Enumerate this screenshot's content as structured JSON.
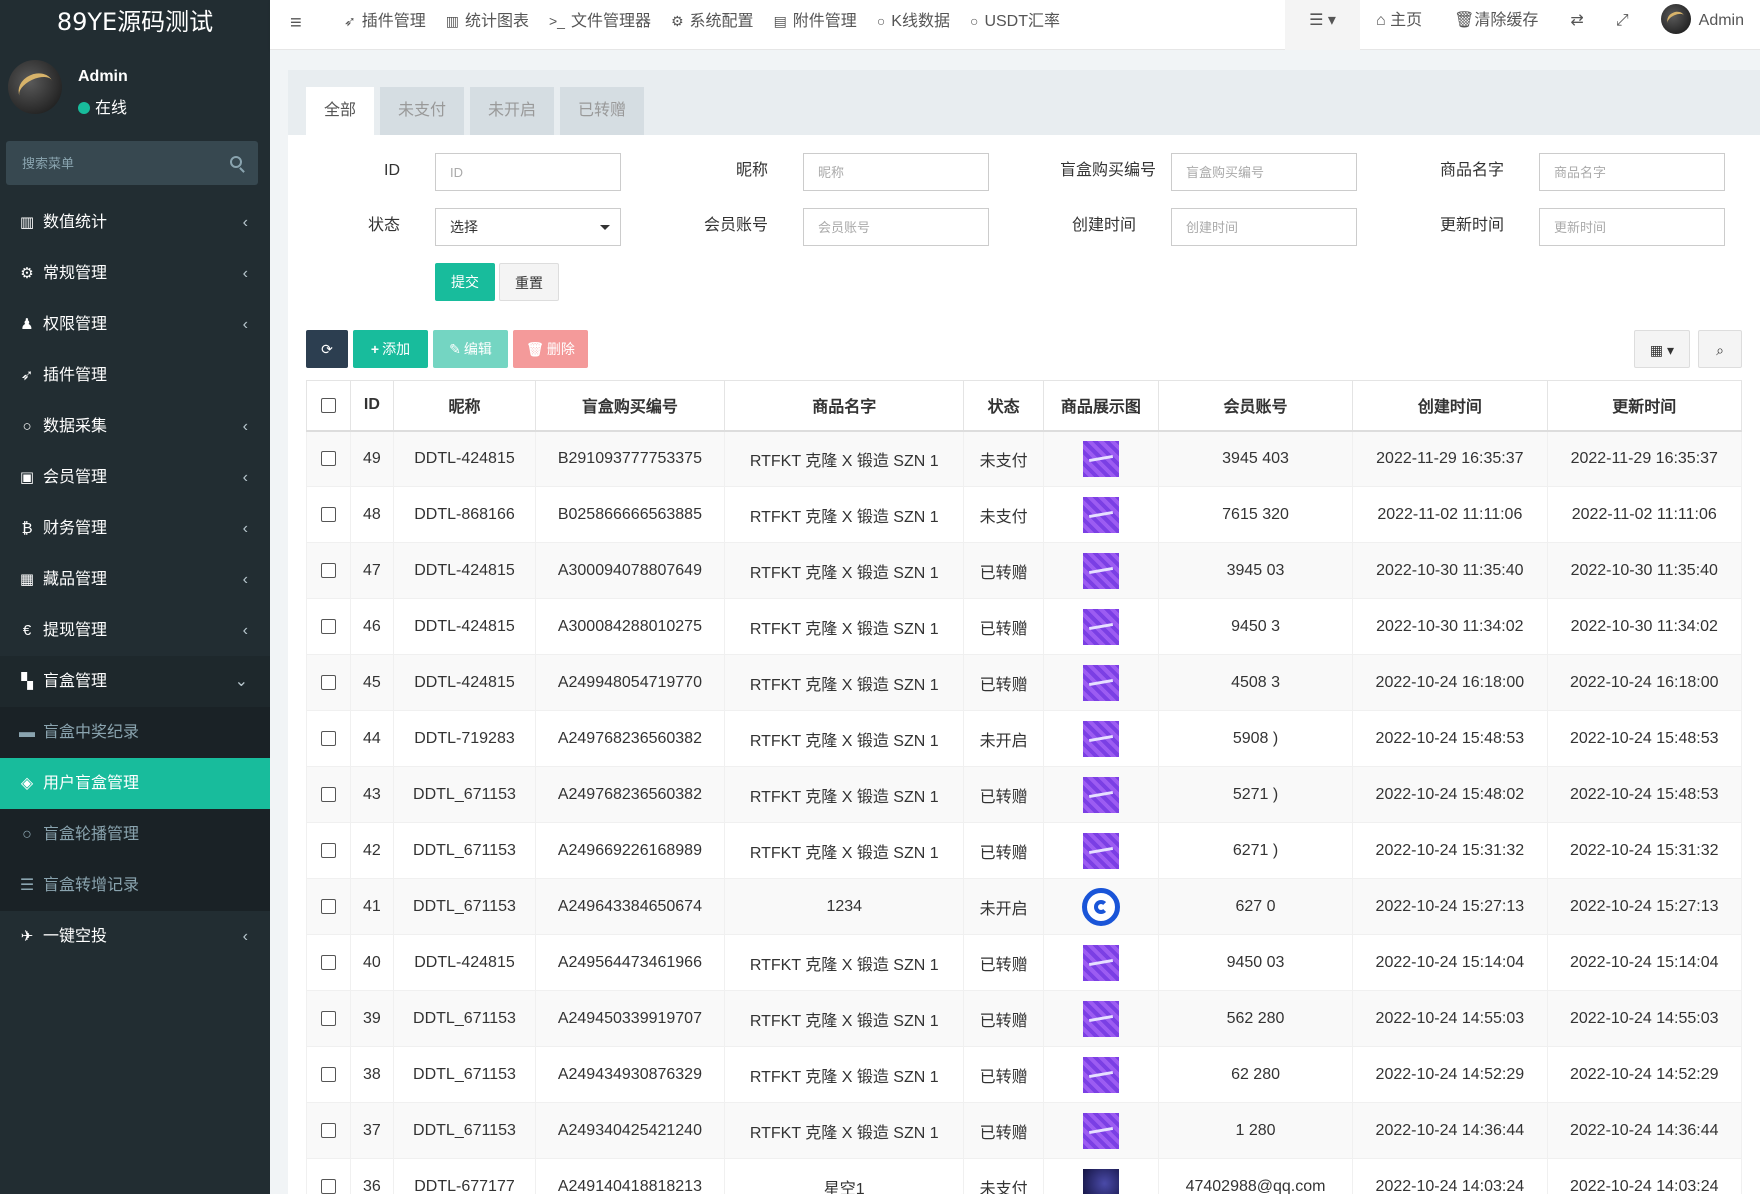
{
  "app": {
    "title": "89YE源码测试"
  },
  "user": {
    "name": "Admin",
    "status": "在线"
  },
  "sidebar": {
    "search_placeholder": "搜索菜单",
    "items": [
      {
        "label": "数值统计",
        "icon": "bar-chart-icon"
      },
      {
        "label": "常规管理",
        "icon": "cogs-icon"
      },
      {
        "label": "权限管理",
        "icon": "users-icon"
      },
      {
        "label": "插件管理",
        "icon": "rocket-icon"
      },
      {
        "label": "数据采集",
        "icon": "circle-icon"
      },
      {
        "label": "会员管理",
        "icon": "id-card-icon"
      },
      {
        "label": "财务管理",
        "icon": "bitcoin-icon"
      },
      {
        "label": "藏品管理",
        "icon": "calendar-icon"
      },
      {
        "label": "提现管理",
        "icon": "euro-icon"
      },
      {
        "label": "盲盒管理",
        "icon": "th-large-icon"
      }
    ],
    "sub_items": [
      {
        "label": "盲盒中奖纪录",
        "icon": "credit-card-icon"
      },
      {
        "label": "用户盲盒管理",
        "icon": "cube-icon"
      },
      {
        "label": "盲盒轮播管理",
        "icon": "circle-icon"
      },
      {
        "label": "盲盒转增记录",
        "icon": "list-icon"
      }
    ],
    "last_item": {
      "label": "一键空投",
      "icon": "plane-icon"
    }
  },
  "topnav": {
    "tabs": [
      {
        "label": "插件管理",
        "icon": "rocket-icon"
      },
      {
        "label": "统计图表",
        "icon": "bar-chart-icon"
      },
      {
        "label": "文件管理器",
        "icon": "terminal-icon"
      },
      {
        "label": "系统配置",
        "icon": "gear-icon"
      },
      {
        "label": "附件管理",
        "icon": "file-image-icon"
      },
      {
        "label": "K线数据",
        "icon": "circle-icon"
      },
      {
        "label": "USDT汇率",
        "icon": "circle-icon"
      }
    ],
    "home": "主页",
    "clear_cache": "清除缓存",
    "user": "Admin"
  },
  "tabs": [
    "全部",
    "未支付",
    "未开启",
    "已转赠"
  ],
  "filters": {
    "id": {
      "label": "ID",
      "placeholder": "ID"
    },
    "nickname": {
      "label": "昵称",
      "placeholder": "昵称"
    },
    "order_no": {
      "label": "盲盒购买编号",
      "placeholder": "盲盒购买编号"
    },
    "goods_name": {
      "label": "商品名字",
      "placeholder": "商品名字"
    },
    "status": {
      "label": "状态",
      "value": "选择"
    },
    "member": {
      "label": "会员账号",
      "placeholder": "会员账号"
    },
    "created": {
      "label": "创建时间",
      "placeholder": "创建时间"
    },
    "updated": {
      "label": "更新时间",
      "placeholder": "更新时间"
    },
    "submit": "提交",
    "reset": "重置"
  },
  "toolbar": {
    "add": "添加",
    "edit": "编辑",
    "delete": "删除"
  },
  "columns": [
    "ID",
    "昵称",
    "盲盒购买编号",
    "商品名字",
    "状态",
    "商品展示图",
    "会员账号",
    "创建时间",
    "更新时间"
  ],
  "rows": [
    {
      "id": "49",
      "nick": "DDTL-424815",
      "order": "B291093777753375",
      "goods": "RTFKT 克隆 X 锻造 SZN 1",
      "status": "未支付",
      "img": "purple",
      "member": "3945  403",
      "created": "2022-11-29 16:35:37",
      "updated": "2022-11-29 16:35:37"
    },
    {
      "id": "48",
      "nick": "DDTL-868166",
      "order": "B025866666563885",
      "goods": "RTFKT 克隆 X 锻造 SZN 1",
      "status": "未支付",
      "img": "purple",
      "member": "7615  320",
      "created": "2022-11-02 11:11:06",
      "updated": "2022-11-02 11:11:06"
    },
    {
      "id": "47",
      "nick": "DDTL-424815",
      "order": "A300094078807649",
      "goods": "RTFKT 克隆 X 锻造 SZN 1",
      "status": "已转赠",
      "img": "purple",
      "member": "3945  03",
      "created": "2022-10-30 11:35:40",
      "updated": "2022-10-30 11:35:40"
    },
    {
      "id": "46",
      "nick": "DDTL-424815",
      "order": "A300084288010275",
      "goods": "RTFKT 克隆 X 锻造 SZN 1",
      "status": "已转赠",
      "img": "purple",
      "member": "9450  3",
      "created": "2022-10-30 11:34:02",
      "updated": "2022-10-30 11:34:02"
    },
    {
      "id": "45",
      "nick": "DDTL-424815",
      "order": "A249948054719770",
      "goods": "RTFKT 克隆 X 锻造 SZN 1",
      "status": "已转赠",
      "img": "purple",
      "member": "4508  3",
      "created": "2022-10-24 16:18:00",
      "updated": "2022-10-24 16:18:00"
    },
    {
      "id": "44",
      "nick": "DDTL-719283",
      "order": "A249768236560382",
      "goods": "RTFKT 克隆 X 锻造 SZN 1",
      "status": "未开启",
      "img": "purple",
      "member": "5908  )",
      "created": "2022-10-24 15:48:53",
      "updated": "2022-10-24 15:48:53"
    },
    {
      "id": "43",
      "nick": "DDTL_671153",
      "order": "A249768236560382",
      "goods": "RTFKT 克隆 X 锻造 SZN 1",
      "status": "已转赠",
      "img": "purple",
      "member": "5271  )",
      "created": "2022-10-24 15:48:02",
      "updated": "2022-10-24 15:48:53"
    },
    {
      "id": "42",
      "nick": "DDTL_671153",
      "order": "A249669226168989",
      "goods": "RTFKT 克隆 X 锻造 SZN 1",
      "status": "已转赠",
      "img": "purple",
      "member": "6271  )",
      "created": "2022-10-24 15:31:32",
      "updated": "2022-10-24 15:31:32"
    },
    {
      "id": "41",
      "nick": "DDTL_671153",
      "order": "A249643384650674",
      "goods": "1234",
      "status": "未开启",
      "img": "logo",
      "member": "627  0",
      "created": "2022-10-24 15:27:13",
      "updated": "2022-10-24 15:27:13"
    },
    {
      "id": "40",
      "nick": "DDTL-424815",
      "order": "A249564473461966",
      "goods": "RTFKT 克隆 X 锻造 SZN 1",
      "status": "已转赠",
      "img": "purple",
      "member": "9450  03",
      "created": "2022-10-24 15:14:04",
      "updated": "2022-10-24 15:14:04"
    },
    {
      "id": "39",
      "nick": "DDTL_671153",
      "order": "A249450339919707",
      "goods": "RTFKT 克隆 X 锻造 SZN 1",
      "status": "已转赠",
      "img": "purple",
      "member": "562  280",
      "created": "2022-10-24 14:55:03",
      "updated": "2022-10-24 14:55:03"
    },
    {
      "id": "38",
      "nick": "DDTL_671153",
      "order": "A249434930876329",
      "goods": "RTFKT 克隆 X 锻造 SZN 1",
      "status": "已转赠",
      "img": "purple",
      "member": "62  280",
      "created": "2022-10-24 14:52:29",
      "updated": "2022-10-24 14:52:29"
    },
    {
      "id": "37",
      "nick": "DDTL_671153",
      "order": "A249340425421240",
      "goods": "RTFKT 克隆 X 锻造 SZN 1",
      "status": "已转赠",
      "img": "purple",
      "member": "1  280",
      "created": "2022-10-24 14:36:44",
      "updated": "2022-10-24 14:36:44"
    },
    {
      "id": "36",
      "nick": "DDTL-677177",
      "order": "A249140418818213",
      "goods": "星空1",
      "status": "未支付",
      "img": "dark",
      "member": "47402988@qq.com",
      "created": "2022-10-24 14:03:24",
      "updated": "2022-10-24 14:03:24"
    }
  ],
  "colors": {
    "sidebar_bg": "#222d32",
    "accent": "#18bc9c",
    "danger": "#f05050",
    "dark_btn": "#2c3e50"
  }
}
